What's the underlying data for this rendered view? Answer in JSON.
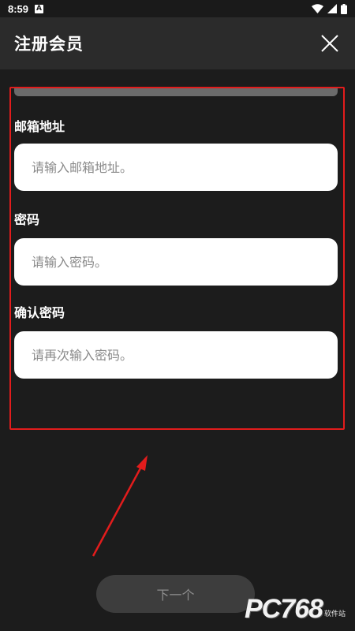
{
  "status_bar": {
    "time": "8:59",
    "notification_letter": "A",
    "icons": [
      "wifi-icon",
      "signal-icon",
      "battery-icon"
    ]
  },
  "header": {
    "title": "注册会员",
    "close_icon": "close-icon"
  },
  "progress": {
    "fraction": 1.0
  },
  "form": {
    "email_label": "邮箱地址",
    "email_placeholder": "请输入邮箱地址。",
    "email_value": "",
    "password_label": "密码",
    "password_placeholder": "请输入密码。",
    "password_value": "",
    "confirm_label": "确认密码",
    "confirm_placeholder": "请再次输入密码。",
    "confirm_value": ""
  },
  "next_button": {
    "label": "下一个"
  },
  "watermark": {
    "text": "PC768",
    "sub": "软件站"
  },
  "colors": {
    "background": "#1c1c1c",
    "header": "#2b2b2b",
    "annotation": "#e21c1c",
    "button_disabled": "#3d3d3d"
  }
}
